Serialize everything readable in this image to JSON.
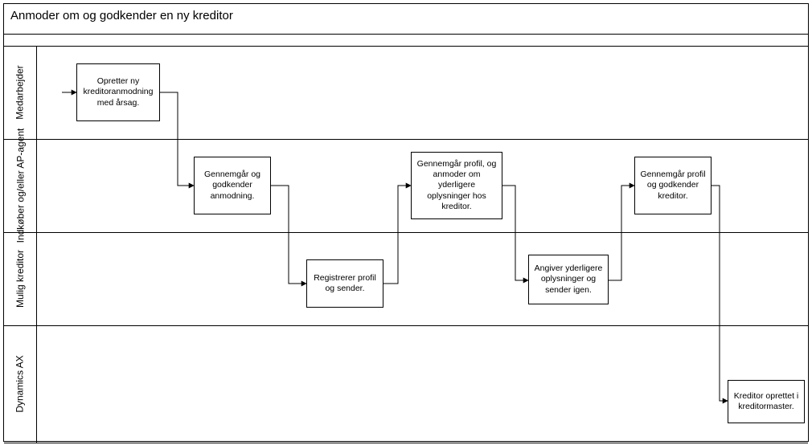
{
  "title": "Anmoder om og godkender en ny kreditor",
  "lanes": {
    "l1": "Medarbejder",
    "l2": "Indkøber og/eller AP-agent",
    "l3": "Mulig kreditor",
    "l4": "Dynamics AX"
  },
  "steps": {
    "s1": "Opretter ny kreditoranmodning med årsag.",
    "s2": "Gennemgår og godkender anmodning.",
    "s3": "Registrerer profil og sender.",
    "s4": "Gennemgår profil, og anmoder om yderligere oplysninger hos kreditor.",
    "s5": "Angiver yderligere oplysninger og sender igen.",
    "s6": "Gennemgår profil og godkender kreditor.",
    "s7": "Kreditor oprettet i kreditormaster."
  }
}
